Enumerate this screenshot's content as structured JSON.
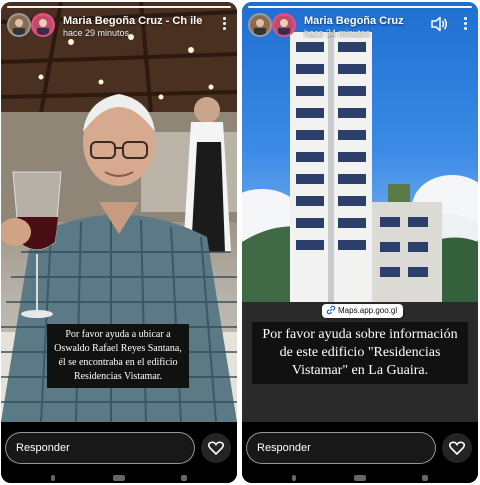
{
  "left_story": {
    "username": "Maria Begoña Cruz - Ch ile",
    "timestamp": "hace 29 minutos",
    "caption": "Por favor ayuda a ubicar a Oswaldo Rafael Reyes Santana, él se encontraba en el edificio Residencias Vistamar.",
    "reply_placeholder": "Responder"
  },
  "right_story": {
    "username": "Maria Begoña Cruz",
    "timestamp": "hace 34 minutos",
    "link_chip": "Maps.app.goo.gl",
    "caption": "Por favor ayuda sobre información de este edificio \"Residencias Vistamar\" en La Guaira.",
    "reply_placeholder": "Responder"
  },
  "icons": {
    "sound": "speaker-sound-icon",
    "menu": "more-vertical-icon",
    "like": "heart-icon",
    "link": "link-icon"
  },
  "colors": {
    "story_ring": "#e94b87",
    "caption_bg": "#111111"
  }
}
